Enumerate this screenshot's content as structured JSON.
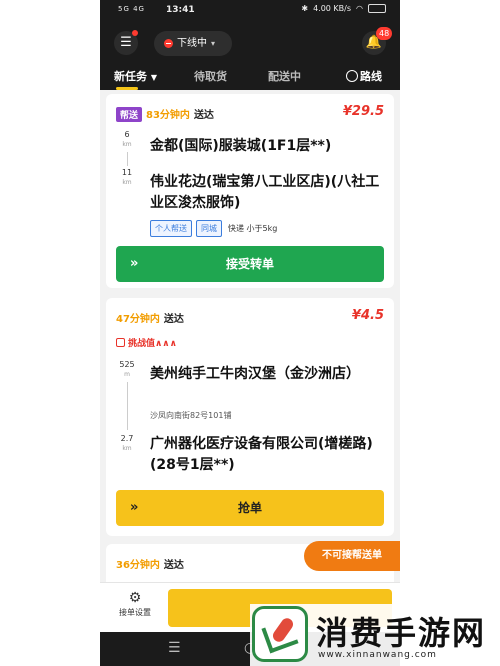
{
  "status_bar": {
    "signal": "5G 4G",
    "time": "13:41",
    "speed": "4.00 KB/s",
    "battery": ""
  },
  "header": {
    "menu_icon": "menu-icon",
    "status_label": "下线中",
    "notification_count": "48"
  },
  "tabs": [
    {
      "label": "新任务"
    },
    {
      "label": "待取货"
    },
    {
      "label": "配送中"
    },
    {
      "label": "路线"
    }
  ],
  "orders": [
    {
      "tag": "帮送",
      "time": "83分钟内",
      "deliver": "送达",
      "price": "¥29.5",
      "pickup_distance": "6",
      "pickup_unit": "km",
      "pickup": "金都(国际)服装城(1F1层**)",
      "drop_distance": "11",
      "drop_unit": "km",
      "drop": "伟业花边(瑞宝第八工业区店)(八社工业区浚杰服饰)",
      "chips": [
        "个人帮送",
        "同城",
        "快递 小于5kg"
      ],
      "button": "接受转单"
    },
    {
      "time": "47分钟内",
      "deliver": "送达",
      "price": "¥4.5",
      "challenge": "挑战值∧∧∧",
      "pickup_distance": "525",
      "pickup_unit": "m",
      "pickup": "美州纯手工牛肉汉堡（金沙洲店）",
      "pickup_sub": "沙凤向南街82号101铺",
      "drop_distance": "2.7",
      "drop_unit": "km",
      "drop": "广州器化医疗设备有限公司(增槎路)(28号1层**)",
      "button": "抢单"
    },
    {
      "time": "36分钟内",
      "deliver": "送达",
      "badge": "不可接帮送单"
    }
  ],
  "bottom": {
    "settings_label": "接单设置"
  },
  "watermark": {
    "title": "消费手游网",
    "url": "www.xinnanwang.com"
  },
  "colors": {
    "accent_yellow": "#f6c21b",
    "accept_green": "#1fa650",
    "price_red": "#e8332a",
    "time_orange": "#f29d00"
  }
}
